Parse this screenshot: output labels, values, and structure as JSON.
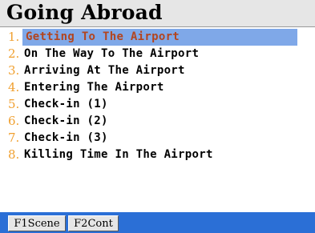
{
  "header": {
    "title": "Going Abroad"
  },
  "menu": {
    "selected_index": 0,
    "items": [
      {
        "number": "1.",
        "label": "Getting To The Airport"
      },
      {
        "number": "2.",
        "label": "On The Way To The Airport"
      },
      {
        "number": "3.",
        "label": "Arriving At The Airport"
      },
      {
        "number": "4.",
        "label": "Entering The Airport"
      },
      {
        "number": "5.",
        "label": "Check-in (1)"
      },
      {
        "number": "6.",
        "label": "Check-in (2)"
      },
      {
        "number": "7.",
        "label": "Check-in (3)"
      },
      {
        "number": "8.",
        "label": "Killing Time In The Airport"
      }
    ]
  },
  "softkeys": {
    "f1_label": "F1Scene",
    "f2_label": "F2Cont"
  },
  "colors": {
    "highlight": "#7fa8e8",
    "selected_text": "#b3451f",
    "number": "#f0a030",
    "bottom_bar": "#2b6fd6"
  }
}
